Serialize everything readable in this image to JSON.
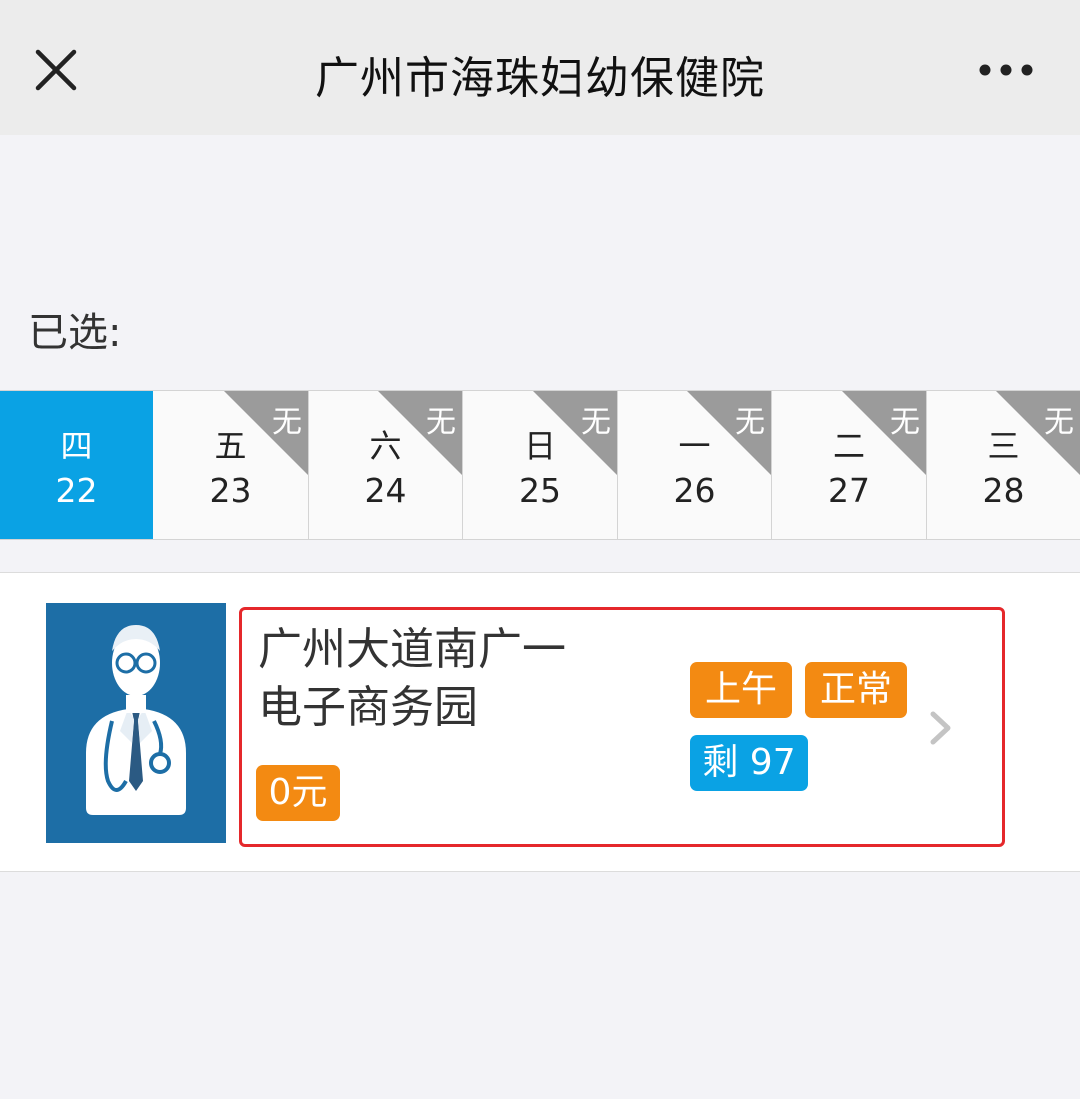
{
  "header": {
    "title": "广州市海珠妇幼保健院"
  },
  "selected_label": "已选:",
  "dates": [
    {
      "weekday": "四",
      "day": "22",
      "active": true
    },
    {
      "weekday": "五",
      "day": "23",
      "status": "无"
    },
    {
      "weekday": "六",
      "day": "24",
      "status": "无"
    },
    {
      "weekday": "日",
      "day": "25",
      "status": "无"
    },
    {
      "weekday": "一",
      "day": "26",
      "status": "无"
    },
    {
      "weekday": "二",
      "day": "27",
      "status": "无"
    },
    {
      "weekday": "三",
      "day": "28",
      "status": "无"
    }
  ],
  "schedule": {
    "location_line1": "广州大道南广一",
    "location_line2": "电子商务园",
    "price": "0元",
    "period": "上午",
    "status": "正常",
    "remaining": "剩 97"
  },
  "colors": {
    "accent_blue": "#0aa2e4",
    "badge_orange": "#f38a12",
    "highlight_red": "#e5282b",
    "no_slot_gray": "#9b9b9b"
  },
  "icons": [
    "close-icon",
    "more-icon",
    "doctor-avatar",
    "chevron-right-icon"
  ]
}
